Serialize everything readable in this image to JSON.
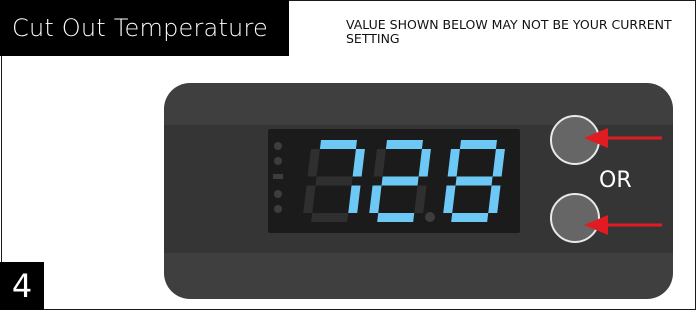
{
  "header": {
    "title": "Cut Out Temperature",
    "notice": "VALUE SHOWN BELOW MAY NOT BE YOUR CURRENT SETTING"
  },
  "step": {
    "number": "4"
  },
  "controller": {
    "display_value": "72.8",
    "display_color": "#6ec8f5",
    "buttons": [
      {
        "name": "up-button"
      },
      {
        "name": "down-button"
      }
    ],
    "or_label": "OR",
    "arrow_color": "#e01b22"
  }
}
